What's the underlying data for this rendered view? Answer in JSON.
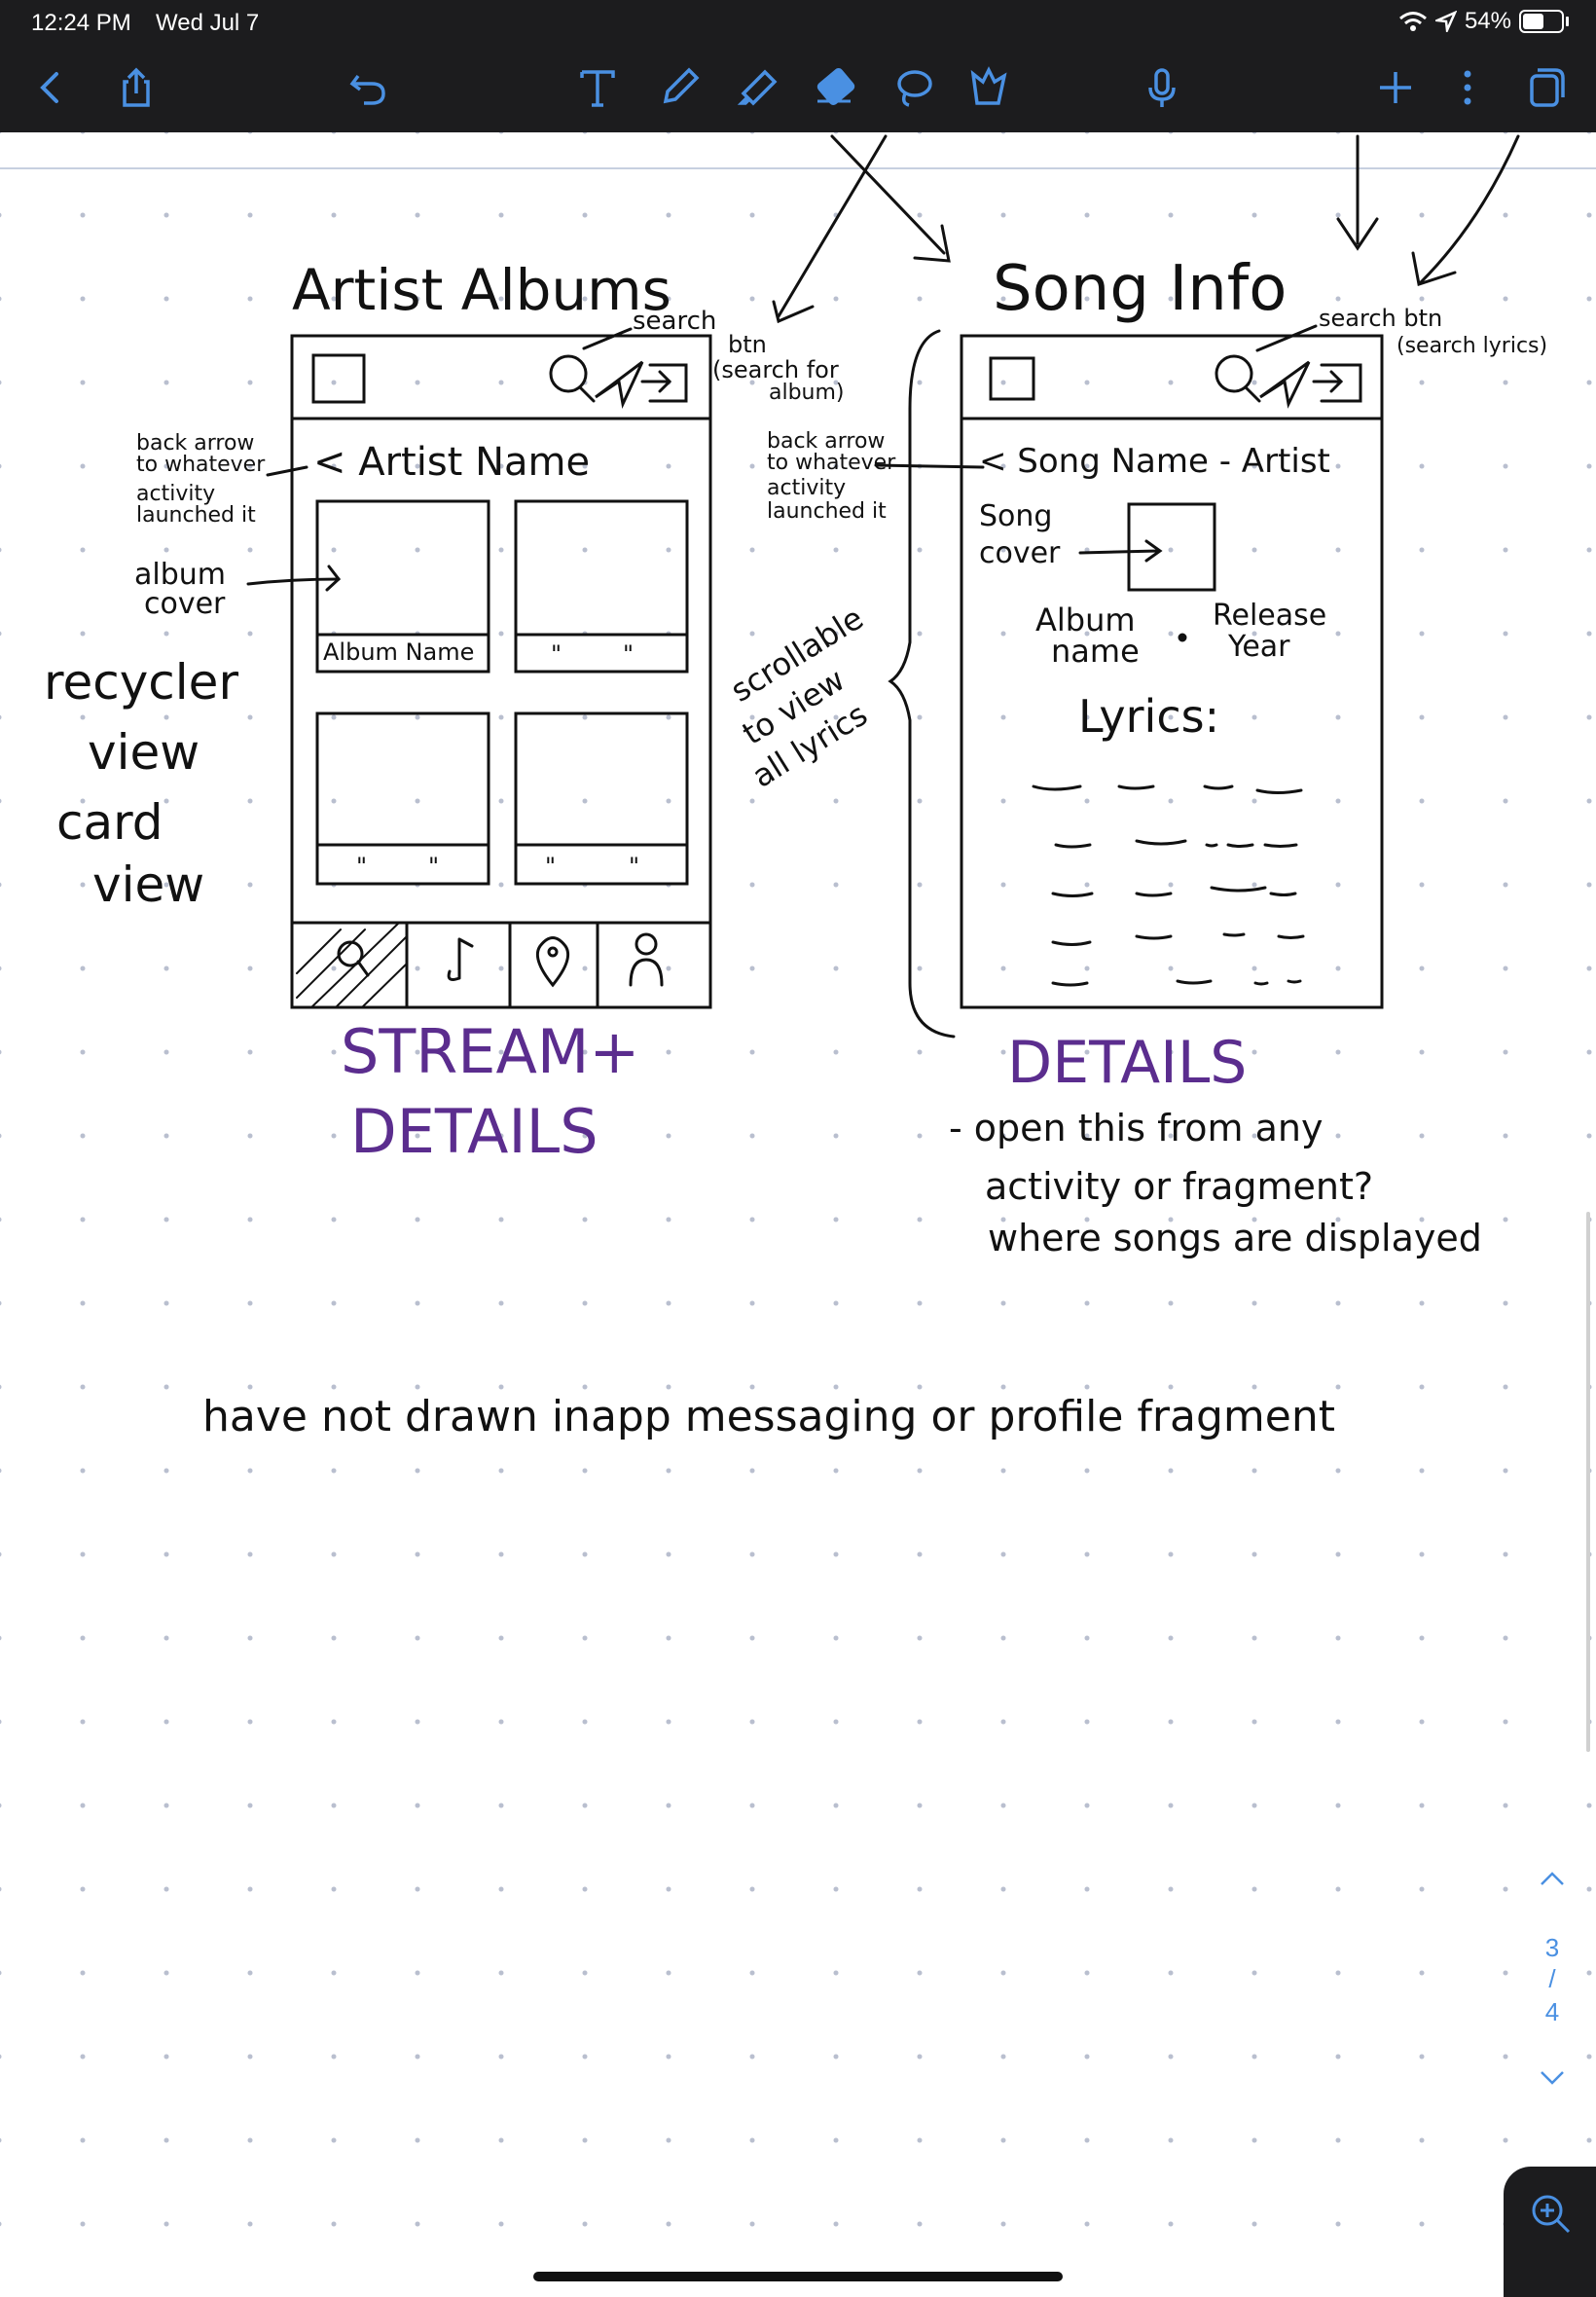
{
  "status_bar": {
    "time": "12:24 PM",
    "date": "Wed Jul 7",
    "battery_percent": "54%",
    "battery_level": 0.54
  },
  "toolbar": {
    "buttons": [
      {
        "name": "back-icon"
      },
      {
        "name": "share-icon"
      },
      {
        "name": "undo-icon"
      },
      {
        "name": "text-tool-icon"
      },
      {
        "name": "pen-tool-icon"
      },
      {
        "name": "highlighter-tool-icon"
      },
      {
        "name": "eraser-tool-icon"
      },
      {
        "name": "lasso-tool-icon"
      },
      {
        "name": "elements-tool-icon"
      },
      {
        "name": "microphone-icon"
      },
      {
        "name": "add-icon"
      },
      {
        "name": "more-icon"
      },
      {
        "name": "pages-icon"
      }
    ],
    "accent_color": "#4a90e2",
    "selected_color": "#4a90e2"
  },
  "sketch": {
    "artist_albums_title": "Artist Albums",
    "song_info_title": "Song Info",
    "search_label_left_1": "search",
    "search_label_left_2": "btn",
    "search_label_left_3": "(search for",
    "search_label_left_4": "album)",
    "search_label_right_1": "search btn",
    "search_label_right_2": "(search lyrics)",
    "back_arrow_left_1": "back arrow",
    "back_arrow_left_2": "to whatever",
    "back_arrow_left_3": "activity",
    "back_arrow_left_4": "launched it",
    "back_arrow_right_1": "back arrow",
    "back_arrow_right_2": "to whatever",
    "back_arrow_right_3": "activity",
    "back_arrow_right_4": "launched it",
    "artist_name": "< Artist Name",
    "song_name_artist": "< Song Name - Artist",
    "album_cover_1": "album",
    "album_cover_2": "cover",
    "album_name": "Album Name",
    "ditto": "\"",
    "recycler_1": "recycler",
    "recycler_2": "view",
    "recycler_3": "card",
    "recycler_4": "view",
    "scrollable_1": "scrollable",
    "scrollable_2": "to view",
    "scrollable_3": "all lyrics",
    "song_cover_1": "Song",
    "song_cover_2": "cover",
    "album_name_1": "Album",
    "album_name_2": "name",
    "release_year_1": "Release",
    "release_year_2": "Year",
    "lyrics_label": "Lyrics:",
    "stream_details_1": "STREAM+",
    "stream_details_2": "DETAILS",
    "details_label": "DETAILS",
    "note_1": "- open this from any",
    "note_2": "activity or fragment?",
    "note_3": "where songs are displayed",
    "bottom_note": "have not drawn inapp messaging or profile fragment",
    "ink_color": "#111111",
    "purple_ink": "#5b2d8e"
  },
  "page_nav": {
    "current": "3",
    "separator": "/",
    "total": "4"
  }
}
